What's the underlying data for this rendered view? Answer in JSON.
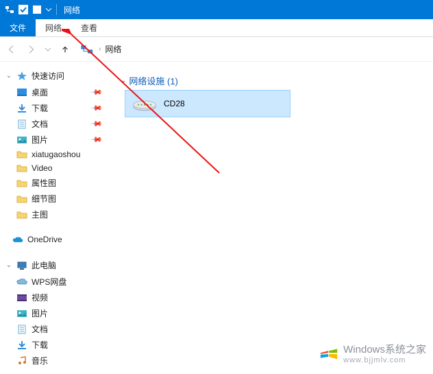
{
  "titlebar": {
    "title": "网络"
  },
  "ribbon": {
    "file": "文件",
    "network_tab": "网络",
    "view_tab": "查看"
  },
  "addrbar": {
    "location": "网络"
  },
  "sidebar": {
    "quick_access": "快速访问",
    "items_pinned": [
      {
        "label": "桌面",
        "icon": "desktop"
      },
      {
        "label": "下载",
        "icon": "download"
      },
      {
        "label": "文档",
        "icon": "document"
      },
      {
        "label": "图片",
        "icon": "pictures"
      }
    ],
    "items_folders": [
      {
        "label": "xiatugaoshou"
      },
      {
        "label": "Video"
      },
      {
        "label": "属性图"
      },
      {
        "label": "细节图"
      },
      {
        "label": "主图"
      }
    ],
    "onedrive": "OneDrive",
    "this_pc": "此电脑",
    "pc_items": [
      {
        "label": "WPS网盘",
        "icon": "cloud"
      },
      {
        "label": "视频",
        "icon": "video"
      },
      {
        "label": "图片",
        "icon": "pictures"
      },
      {
        "label": "文档",
        "icon": "document"
      },
      {
        "label": "下载",
        "icon": "download"
      },
      {
        "label": "音乐",
        "icon": "music"
      }
    ]
  },
  "content": {
    "section_label": "网络设施 (1)",
    "device": "CD28"
  },
  "watermark": {
    "main": "Windows系统之家",
    "sub": "www.bjjmlv.com"
  }
}
